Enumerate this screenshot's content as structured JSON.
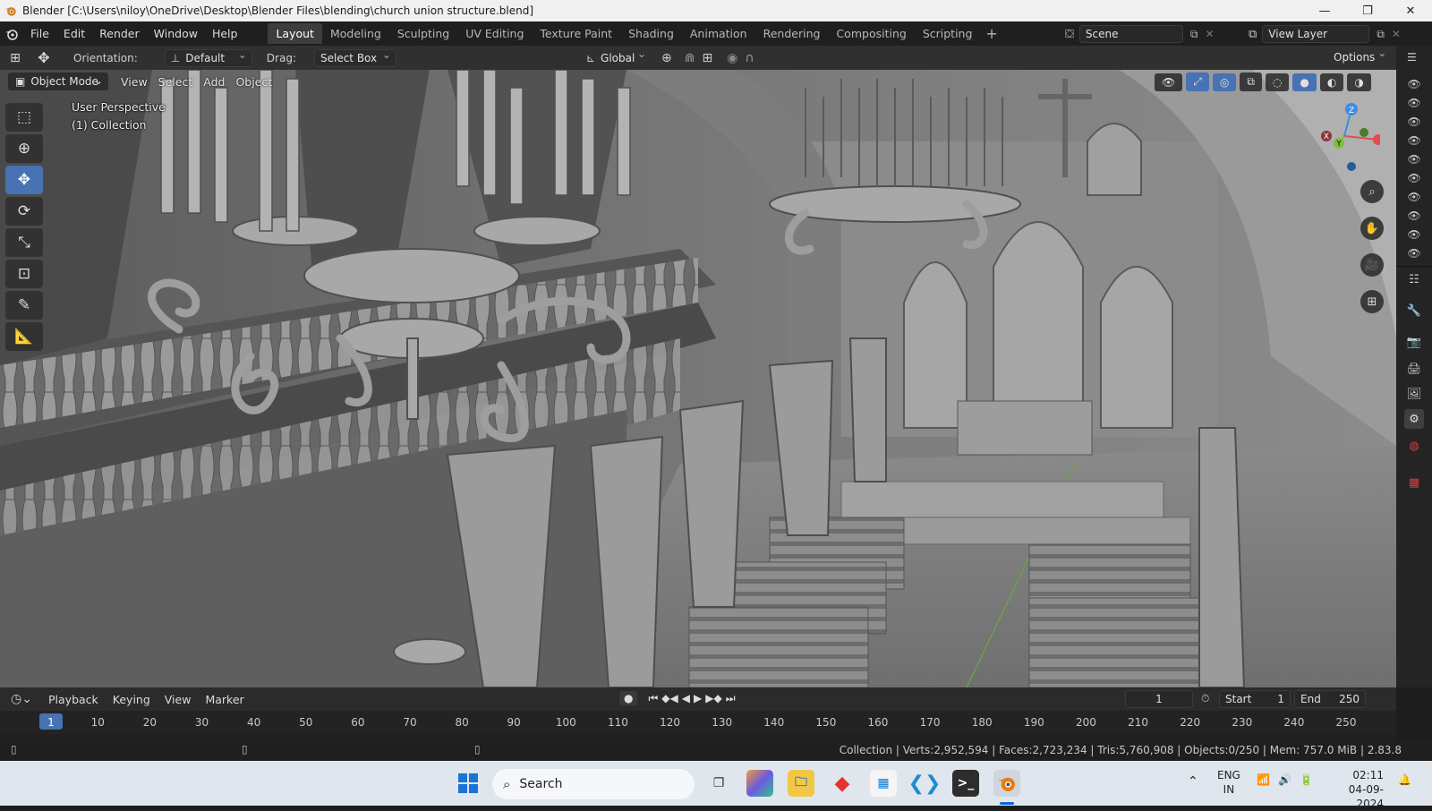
{
  "window": {
    "title": "Blender [C:\\Users\\niloy\\OneDrive\\Desktop\\Blender Files\\blending\\church union structure.blend]",
    "controls": [
      "—",
      "❐",
      "✕"
    ]
  },
  "menubar": {
    "items": [
      "File",
      "Edit",
      "Render",
      "Window",
      "Help"
    ],
    "workspaces": [
      "Layout",
      "Modeling",
      "Sculpting",
      "UV Editing",
      "Texture Paint",
      "Shading",
      "Animation",
      "Rendering",
      "Compositing",
      "Scripting"
    ],
    "active_workspace": "Layout",
    "add_tab": "+",
    "scene_label": "Scene",
    "view_layer_label": "View Layer"
  },
  "header": {
    "orientation_label": "Orientation:",
    "orientation_value": "Default",
    "drag_label": "Drag:",
    "drag_value": "Select Box",
    "transform_orientation": "Global",
    "options_label": "Options"
  },
  "viewport": {
    "mode": "Object Mode",
    "menus": [
      "View",
      "Select",
      "Add",
      "Object"
    ],
    "info_line1": "User Perspective",
    "info_line2": "(1) Collection",
    "gizmo_axes": {
      "x": "X",
      "y": "Y",
      "z": "Z"
    },
    "active_tool": "move"
  },
  "timeline": {
    "menus": [
      "Playback",
      "Keying",
      "View",
      "Marker"
    ],
    "current_frame": "1",
    "start_label": "Start",
    "start_value": "1",
    "end_label": "End",
    "end_value": "250",
    "ruler_ticks": [
      "1",
      "10",
      "20",
      "30",
      "40",
      "50",
      "60",
      "70",
      "80",
      "90",
      "100",
      "110",
      "120",
      "130",
      "140",
      "150",
      "160",
      "170",
      "180",
      "190",
      "200",
      "210",
      "220",
      "230",
      "240",
      "250"
    ]
  },
  "statusbar": {
    "text": "Collection | Verts:2,952,594 | Faces:2,723,234 | Tris:5,760,908 | Objects:0/250 | Mem: 757.0 MiB | 2.83.8"
  },
  "taskbar": {
    "search_placeholder": "Search",
    "lang_line1": "ENG",
    "lang_line2": "IN",
    "time": "02:11",
    "date": "04-09-2024"
  },
  "colors": {
    "accent": "#4772b3",
    "active_frame": "#4772b3",
    "x_axis": "#e44a53",
    "y_axis": "#7bbf3a",
    "z_axis": "#3e8de0"
  }
}
